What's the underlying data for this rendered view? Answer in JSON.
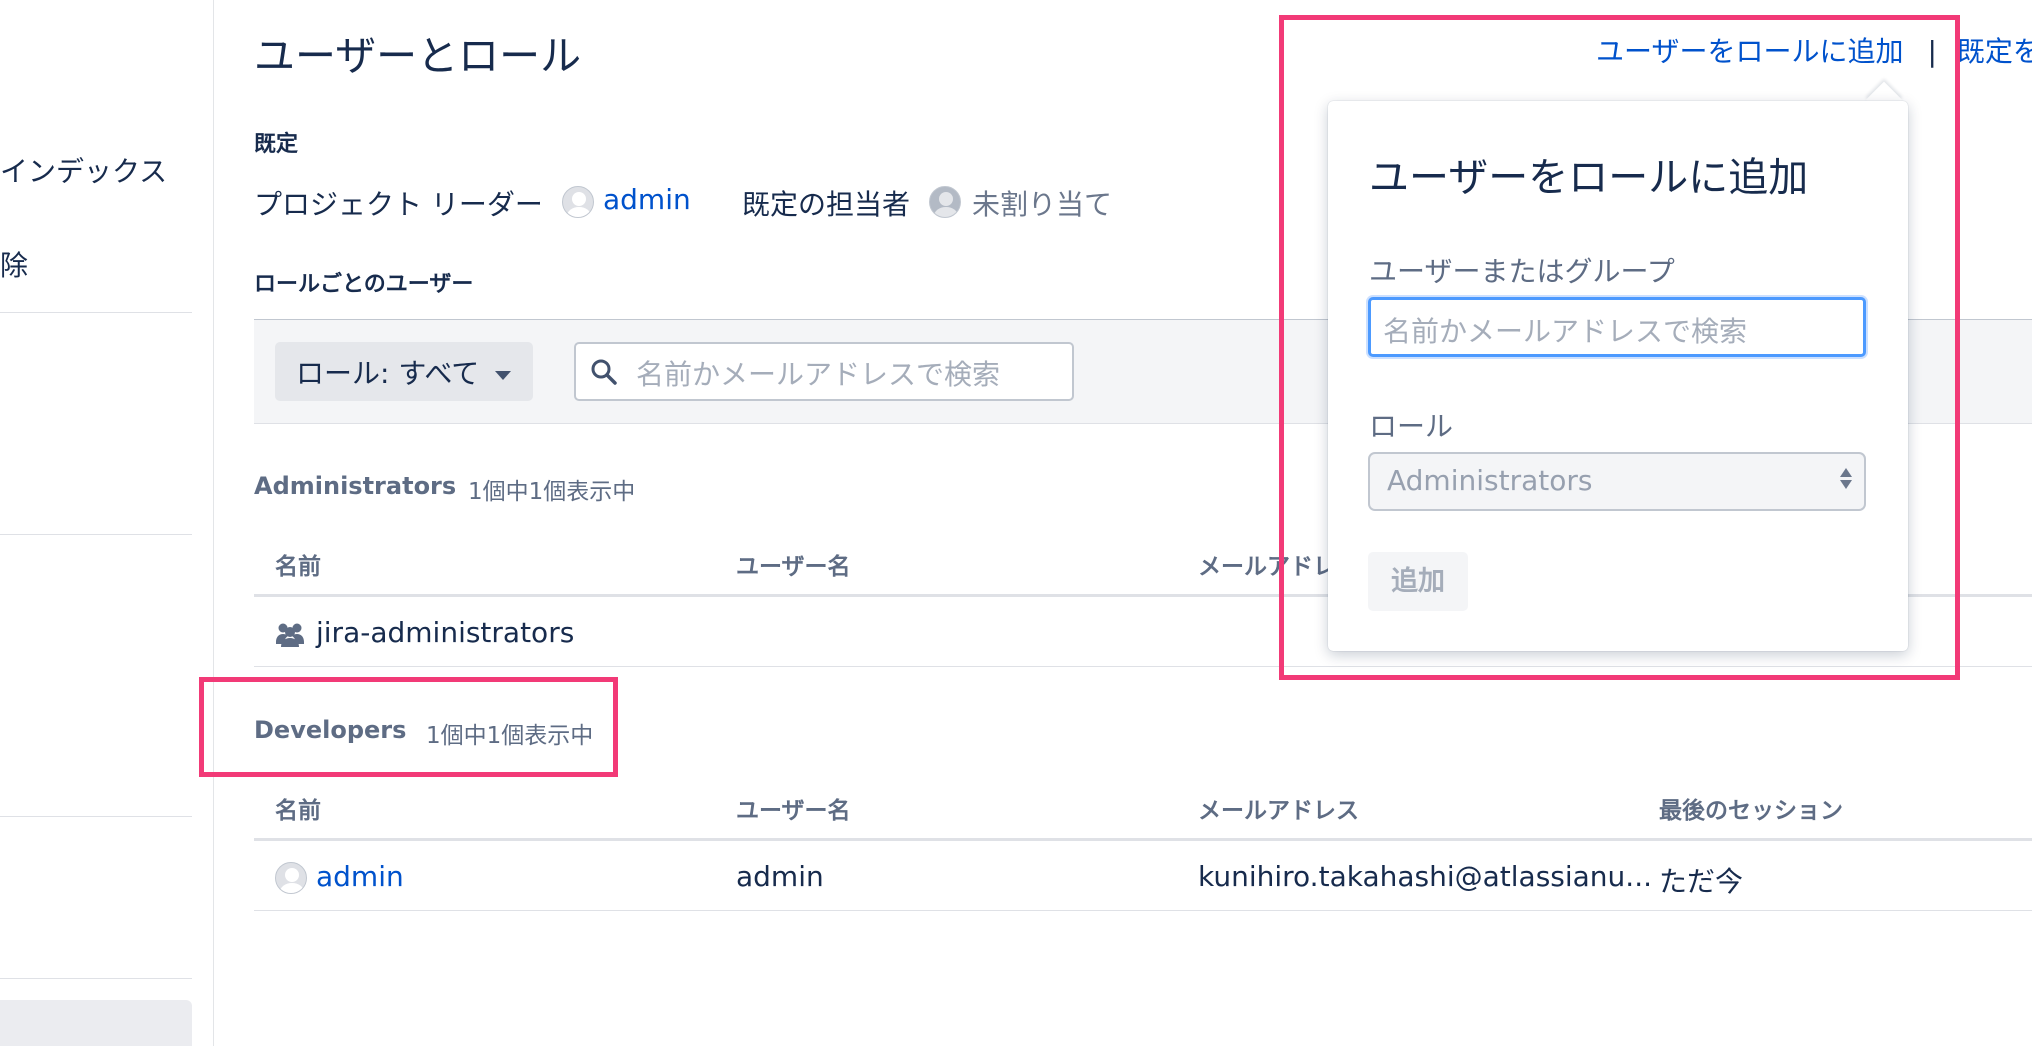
{
  "sidebar": {
    "items": [
      {
        "label": "インデックス"
      },
      {
        "label": "除"
      }
    ]
  },
  "page": {
    "title": "ユーザーとロール"
  },
  "header_links": {
    "add_user": "ユーザーをロールに追加",
    "separator": "|",
    "defaults": "既定を"
  },
  "defaults_section": {
    "heading": "既定",
    "project_lead_label": "プロジェクト リーダー",
    "project_lead_value": "admin",
    "default_assignee_label": "既定の担当者",
    "default_assignee_value": "未割り当て"
  },
  "users_by_role": {
    "heading": "ロールごとのユーザー"
  },
  "filter": {
    "role_button": "ロール: すべて",
    "search_placeholder": "名前かメールアドレスで検索"
  },
  "groups": [
    {
      "name": "Administrators",
      "count": "1個中1個表示中",
      "columns": [
        "名前",
        "ユーザー名",
        "メールアドレ"
      ],
      "rows": [
        {
          "name": "jira-administrators",
          "icon": "group-icon"
        }
      ]
    },
    {
      "name": "Developers",
      "count": "1個中1個表示中",
      "columns": [
        "名前",
        "ユーザー名",
        "メールアドレス",
        "最後のセッション"
      ],
      "rows": [
        {
          "name": "admin",
          "username": "admin",
          "email": "kunihiro.takahashi@atlassianu...",
          "last_session": "ただ今",
          "icon": "user-avatar"
        }
      ]
    }
  ],
  "popover": {
    "title": "ユーザーをロールに追加",
    "user_label": "ユーザーまたはグループ",
    "user_placeholder": "名前かメールアドレスで検索",
    "role_label": "ロール",
    "role_value": "Administrators",
    "add_button": "追加"
  },
  "colors": {
    "highlight": "#f23a77",
    "link": "#0052cc",
    "focus": "#4c9aff"
  }
}
